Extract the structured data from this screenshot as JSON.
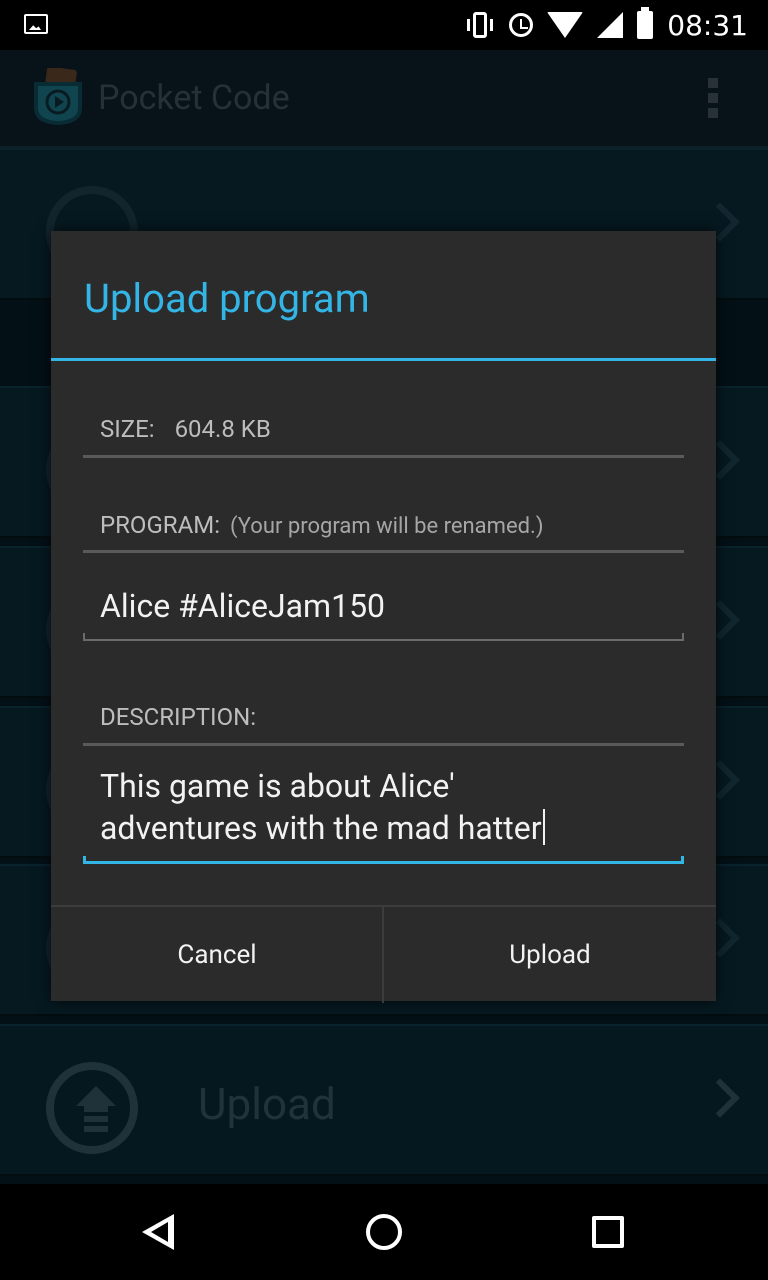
{
  "status_bar": {
    "time": "08:31",
    "icons": [
      "image-icon",
      "vibrate-icon",
      "alarm-icon",
      "wifi-icon",
      "signal-icon",
      "battery-icon"
    ]
  },
  "app_bar": {
    "title": "Pocket Code",
    "overflow_icon": "overflow-menu-icon"
  },
  "background_list": {
    "rows": [
      "",
      "",
      "",
      "",
      ""
    ],
    "upload_label": "Upload"
  },
  "dialog": {
    "title": "Upload program",
    "size_label": "SIZE:",
    "size_value": "604.8 KB",
    "program_label": "PROGRAM:",
    "program_hint": "(Your program will be renamed.)",
    "program_name": "Alice #AliceJam150",
    "description_label": "DESCRIPTION:",
    "description_line1": "This game is about Alice'",
    "description_line2": "adventures with the mad hatter",
    "cancel_label": "Cancel",
    "upload_label": "Upload"
  },
  "colors": {
    "accent": "#33b5e5",
    "dialog_bg": "#2b2b2b",
    "app_bar_bg": "#0b1e26"
  }
}
